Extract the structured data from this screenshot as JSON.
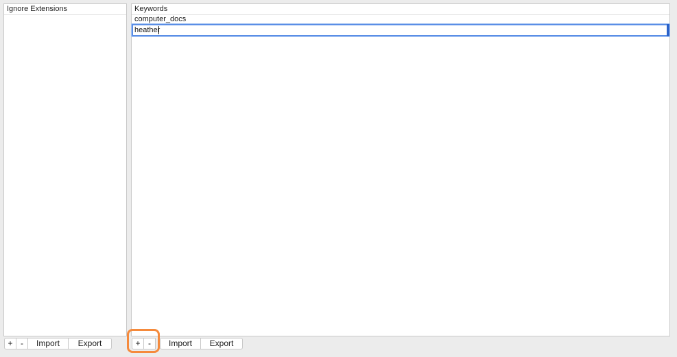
{
  "ignore_extensions": {
    "header": "Ignore Extensions",
    "items": []
  },
  "keywords": {
    "header": "Keywords",
    "items": [
      "computer_docs"
    ],
    "editing_value": "heather"
  },
  "toolbar_left": {
    "add_label": "+",
    "remove_label": "-",
    "import_label": "Import",
    "export_label": "Export"
  },
  "toolbar_right": {
    "add_label": "+",
    "remove_label": "-",
    "import_label": "Import",
    "export_label": "Export"
  },
  "colors": {
    "highlight": "#f58a3c",
    "focus_ring": "#5a8ee6"
  }
}
